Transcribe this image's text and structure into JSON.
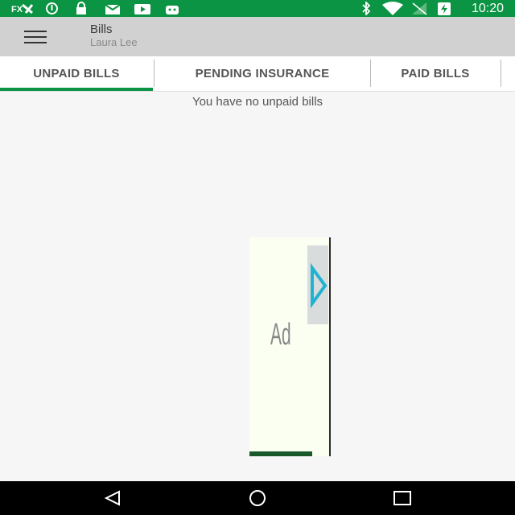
{
  "status_bar": {
    "time": "10:20",
    "left_icons": [
      "notification-icon",
      "info-icon",
      "lock-icon",
      "mail-icon",
      "video-icon",
      "android-icon"
    ],
    "right_icons": [
      "bluetooth-icon",
      "wifi-icon",
      "signal-icon",
      "battery-charging-icon"
    ]
  },
  "toolbar": {
    "title": "Bills",
    "subtitle": "Laura Lee"
  },
  "tabs": [
    {
      "label": "UNPAID BILLS",
      "active": true
    },
    {
      "label": "PENDING INSURANCE",
      "active": false
    },
    {
      "label": "PAID BILLS",
      "active": false
    }
  ],
  "content": {
    "empty_message": "You have no unpaid bills"
  },
  "ad": {
    "label": "Ad"
  },
  "colors": {
    "accent": "#0b9443",
    "toolbar": "#d1d1d1"
  }
}
